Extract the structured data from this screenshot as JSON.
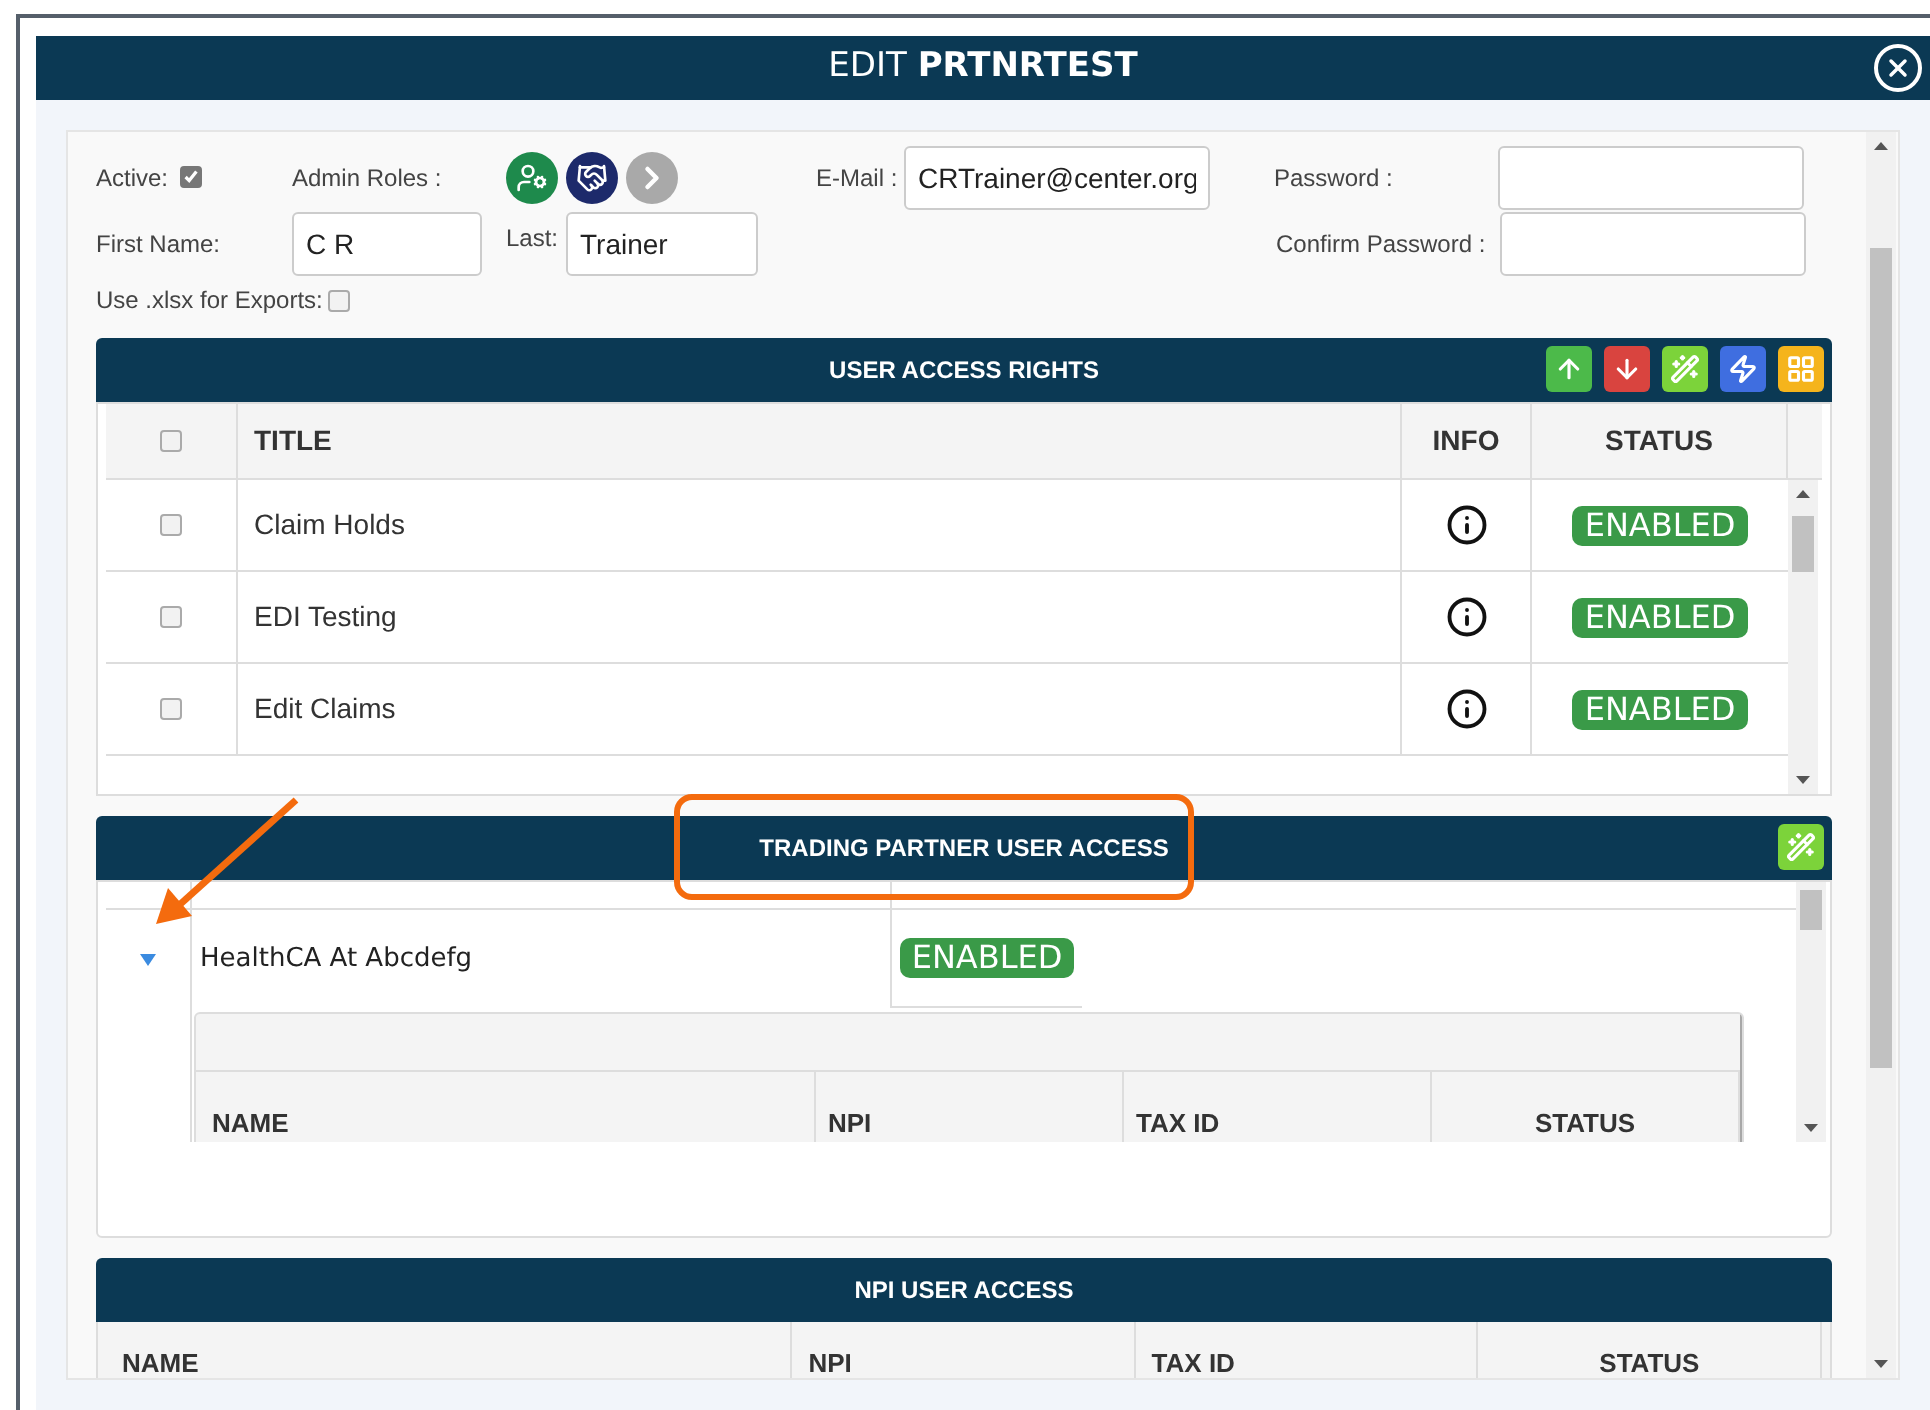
{
  "dialog": {
    "title_prefix": "EDIT",
    "title_name": "PRTNRTEST"
  },
  "form": {
    "active": {
      "label": "Active:",
      "checked": true
    },
    "admin_roles": {
      "label": "Admin Roles :"
    },
    "email": {
      "label": "E-Mail :",
      "value": "CRTrainer@center.org"
    },
    "password": {
      "label": "Password :"
    },
    "first_name": {
      "label": "First Name:",
      "value": "C R"
    },
    "last_name": {
      "label": "Last:",
      "value": "Trainer"
    },
    "confirm_password": {
      "label": "Confirm Password :"
    },
    "xlsx": {
      "label": "Use .xlsx for Exports:",
      "checked": false
    }
  },
  "user_access_rights": {
    "title": "USER ACCESS RIGHTS",
    "select_all_checked": false,
    "columns": [
      "TITLE",
      "INFO",
      "STATUS"
    ],
    "rows": [
      {
        "title": "Claim Holds",
        "checked": false,
        "status": "ENABLED"
      },
      {
        "title": "EDI Testing",
        "checked": false,
        "status": "ENABLED"
      },
      {
        "title": "Edit Claims",
        "checked": false,
        "status": "ENABLED"
      }
    ]
  },
  "trading_partner_access": {
    "title": "TRADING PARTNER USER ACCESS",
    "rows": [
      {
        "name": "HealthCA At Abcdefg",
        "status": "ENABLED",
        "expanded": true,
        "columns": [
          "NAME",
          "NPI",
          "TAX ID",
          "STATUS"
        ]
      }
    ]
  },
  "npi_user_access": {
    "title": "NPI USER ACCESS",
    "columns": [
      "NAME",
      "NPI",
      "TAX ID",
      "STATUS"
    ]
  }
}
